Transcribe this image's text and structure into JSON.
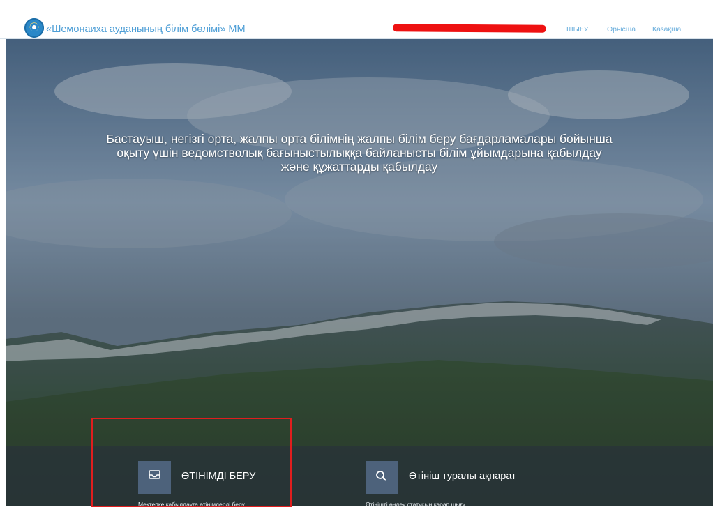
{
  "header": {
    "brand_title": "«Шемонаиха ауданының білім бөлімі» ММ",
    "nav_links": [
      "ШЫҒУ",
      "Орысша",
      "Қазақша"
    ],
    "logo_icon": "organization-emblem-icon",
    "accent_color": "#4d9ed6"
  },
  "hero": {
    "title_lines": [
      "Бастауыш, негізгі орта, жалпы орта білімнің жалпы білім беру бағдарламалары бойынша",
      "оқыту үшін ведомстволық бағыныстылыққа байланысты білім ұйымдарына қабылдау",
      "және құжаттарды қабылдау"
    ]
  },
  "actions": [
    {
      "label": "ӨТІНІМДІ БЕРУ",
      "sublabel": "Мектепке қабылдауға өтінімдерді беру",
      "icon": "inbox-icon"
    },
    {
      "label": "Өтініш туралы ақпарат",
      "sublabel": "Өтінішті өңдеу статусын қарап шығу",
      "icon": "search-icon"
    }
  ],
  "colors": {
    "highlight": "#e01e1e",
    "action_icon_bg": "#4d627b"
  }
}
